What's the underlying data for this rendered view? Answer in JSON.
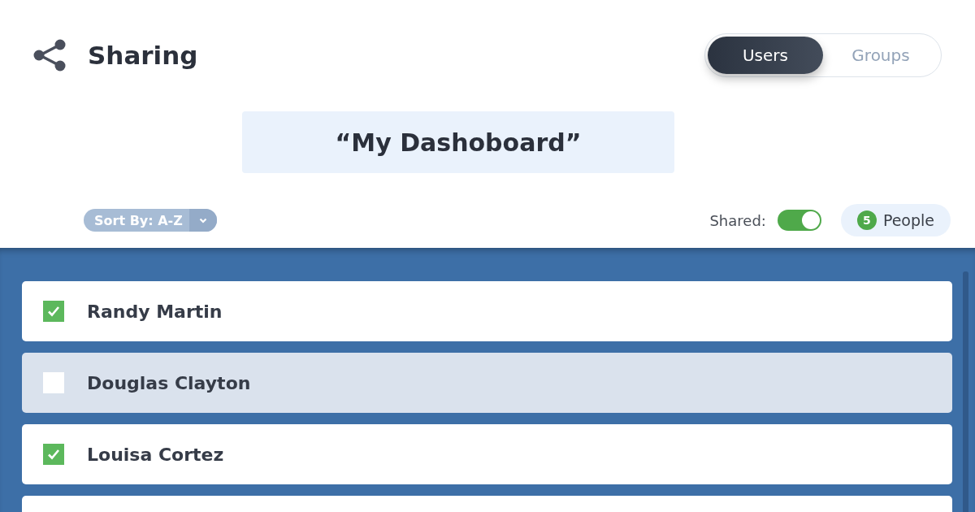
{
  "header": {
    "title": "Sharing"
  },
  "view_tabs": [
    {
      "label": "Users",
      "selected": true
    },
    {
      "label": "Groups",
      "selected": false
    }
  ],
  "dashboard_name": "“My Dashoboard”",
  "sort": {
    "label": "Sort By: A-Z"
  },
  "shared": {
    "label": "Shared:",
    "on": true
  },
  "people": {
    "count": "5",
    "label": "People"
  },
  "users": [
    {
      "name": "Randy Martin",
      "checked": true,
      "selected": false
    },
    {
      "name": "Douglas Clayton",
      "checked": false,
      "selected": true
    },
    {
      "name": "Louisa Cortez",
      "checked": true,
      "selected": false
    },
    {
      "selected": false
    }
  ]
}
